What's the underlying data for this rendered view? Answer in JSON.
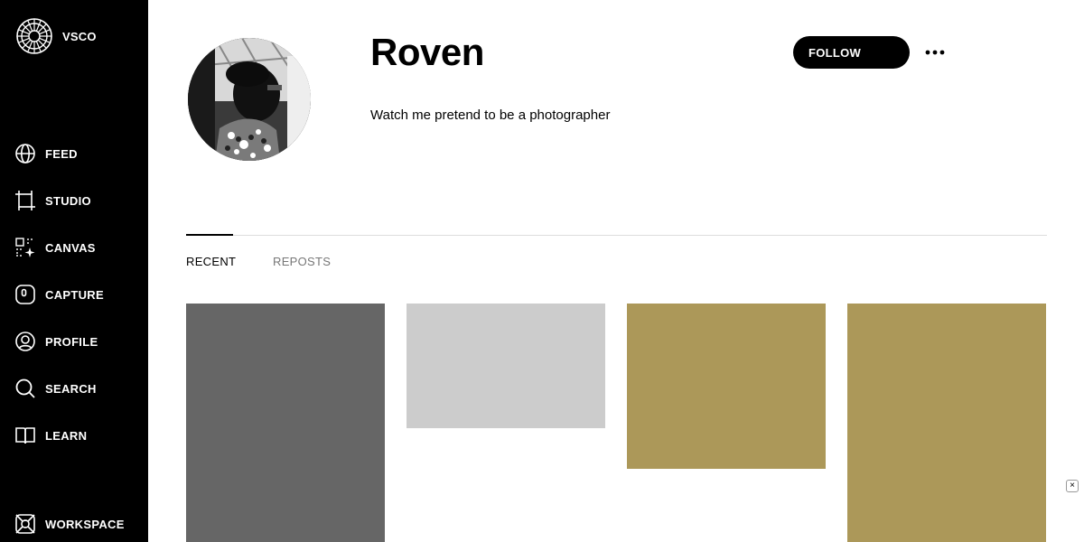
{
  "brand": {
    "name": "VSCO",
    "logo_icon": "vsco-aperture-icon"
  },
  "sidebar": {
    "items": [
      {
        "label": "FEED",
        "icon": "globe-icon"
      },
      {
        "label": "STUDIO",
        "icon": "crop-frame-icon"
      },
      {
        "label": "CANVAS",
        "icon": "canvas-sparkle-icon"
      },
      {
        "label": "CAPTURE",
        "icon": "camera-capture-icon"
      },
      {
        "label": "PROFILE",
        "icon": "profile-icon"
      },
      {
        "label": "SEARCH",
        "icon": "search-icon"
      },
      {
        "label": "LEARN",
        "icon": "book-icon"
      },
      {
        "label": "WORKSPACE",
        "icon": "workspace-icon"
      }
    ]
  },
  "profile": {
    "name": "Roven",
    "bio": "Watch me pretend to be a photographer",
    "follow_label": "FOLLOW",
    "more_icon": "more-horizontal-icon"
  },
  "tabs": [
    {
      "label": "RECENT",
      "active": true
    },
    {
      "label": "REPOSTS",
      "active": false
    }
  ],
  "gallery": [
    {
      "color": "#666666"
    },
    {
      "color": "#cccccc"
    },
    {
      "color": "#ac9859"
    },
    {
      "color": "#ac9859"
    }
  ],
  "overlay": {
    "close_glyph": "×"
  }
}
